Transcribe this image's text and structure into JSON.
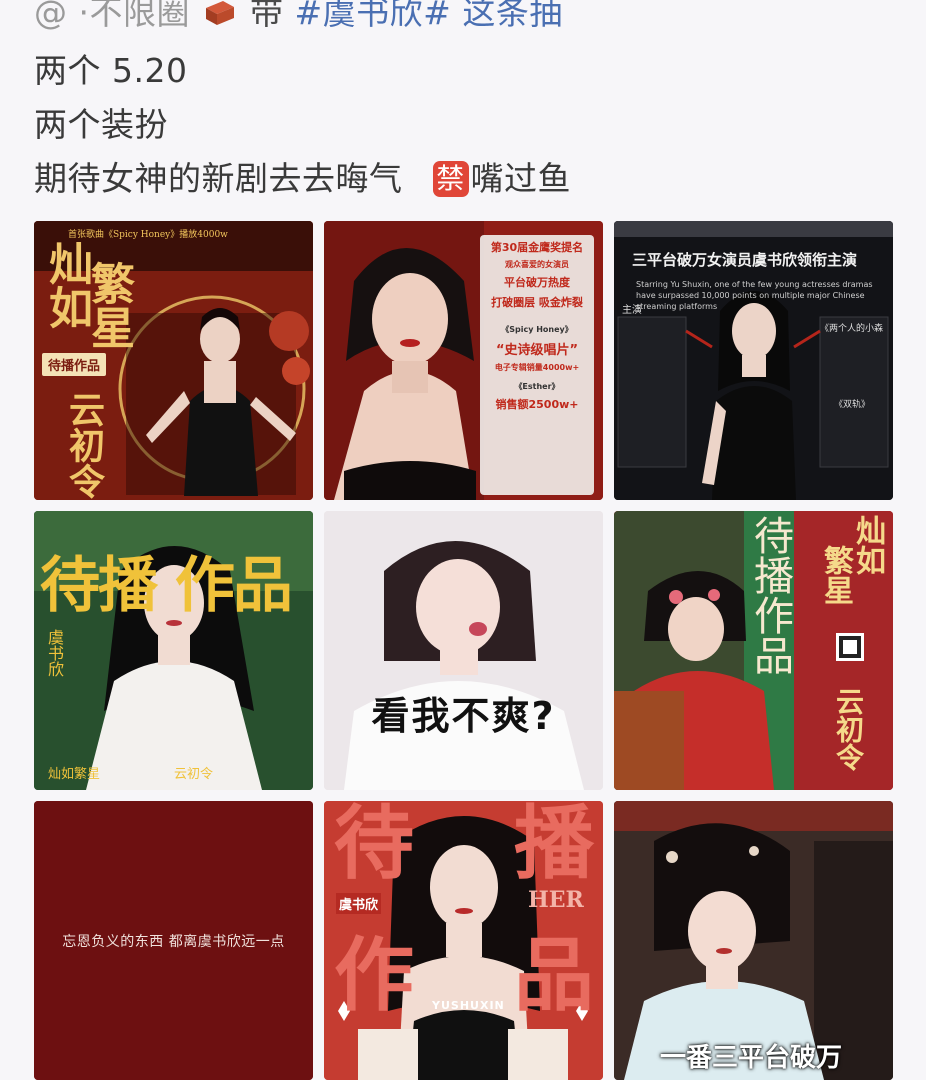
{
  "post": {
    "line1_prefix": "@",
    "line1_handle": "·不限圈",
    "line1_mid": "带",
    "line1_tag": "#虞书欣#",
    "line1_suffix": " 这条抽",
    "line2": "两个 5.20",
    "line3": "两个装扮",
    "line4": "期待女神的新剧去去晦气",
    "ban_glyph": "禁",
    "line4_tail": "嘴过鱼"
  },
  "grid": {
    "tile1": {
      "title_a": "灿如",
      "title_b": "繁星",
      "tag": "待播作品",
      "bottom": "云初令",
      "header": "首张歌曲《Spicy Honey》播放4000w"
    },
    "tile2": {
      "p1": "第30届金鹰奖提名",
      "p2": "观众喜爱的女演员",
      "p3": "平台破万热度",
      "p4": "打破圈层 吸金炸裂",
      "p5": "《Spicy Honey》",
      "p6": "“史诗级唱片”",
      "p7": "电子专辑销量4000w+",
      "p8": "《Esther》",
      "p9": "销售额2500w+"
    },
    "tile3": {
      "title": "三平台破万女演员虞书欣领衔主演",
      "subtitle": "Starring Yu Shuxin, one of the few young actresses dramas have surpassed 10,000 points on multiple major Chinese streaming platforms",
      "left_label": "主演",
      "right_label_1": "《两个人的小森",
      "right_label_2": "《双轨》"
    },
    "tile4": {
      "banner": "待播   作品",
      "name": "虞书欣",
      "bottom_left": "灿如繁星",
      "bottom_right": "云初令"
    },
    "tile5": {
      "meme": "看我不爽?"
    },
    "tile6": {
      "title_a": "灿如",
      "title_b": "繁星",
      "mid": "待播作品",
      "bottom": "云初令"
    },
    "tile7": {
      "quote": "忘恩负义的东西   都离虞书欣远一点"
    },
    "tile8": {
      "big_a": "待",
      "big_b": "播",
      "big_c": "作",
      "big_d": "品",
      "brand": "YUSHUXIN",
      "side": "虞书欣",
      "side_en": "HER"
    },
    "tile9": {
      "caption": "一番三平台破万"
    }
  }
}
